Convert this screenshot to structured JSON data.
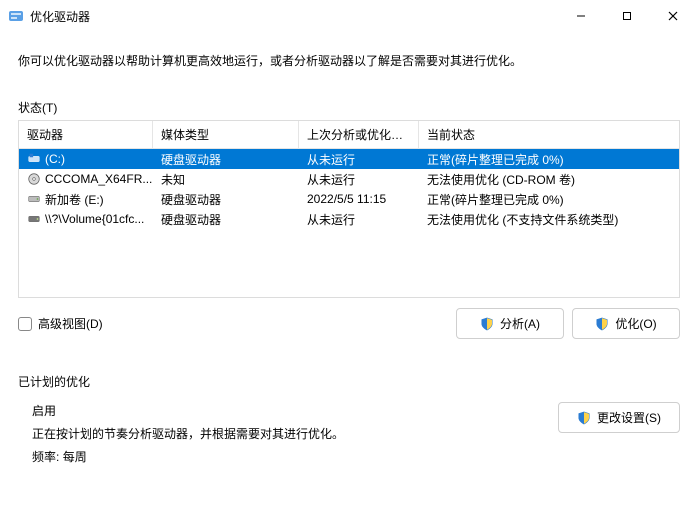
{
  "window": {
    "title": "优化驱动器"
  },
  "description": "你可以优化驱动器以帮助计算机更高效地运行，或者分析驱动器以了解是否需要对其进行优化。",
  "status_label": "状态(T)",
  "columns": {
    "drive": "驱动器",
    "media": "媒体类型",
    "last": "上次分析或优化的...",
    "state": "当前状态"
  },
  "rows": [
    {
      "drive": "(C:)",
      "media": "硬盘驱动器",
      "last": "从未运行",
      "state": "正常(碎片整理已完成 0%)",
      "icon": "drive-os",
      "selected": true
    },
    {
      "drive": "CCCOMA_X64FR...",
      "media": "未知",
      "last": "从未运行",
      "state": "无法使用优化 (CD-ROM 卷)",
      "icon": "drive-cd",
      "selected": false
    },
    {
      "drive": "新加卷 (E:)",
      "media": "硬盘驱动器",
      "last": "2022/5/5 11:15",
      "state": "正常(碎片整理已完成 0%)",
      "icon": "drive-hdd",
      "selected": false
    },
    {
      "drive": "\\\\?\\Volume{01cfc...",
      "media": "硬盘驱动器",
      "last": "从未运行",
      "state": "无法使用优化 (不支持文件系统类型)",
      "icon": "drive-vol",
      "selected": false
    }
  ],
  "advanced_view": "高级视图(D)",
  "buttons": {
    "analyze": "分析(A)",
    "optimize": "优化(O)",
    "change_settings": "更改设置(S)"
  },
  "scheduled": {
    "title": "已计划的优化",
    "on": "启用",
    "desc": "正在按计划的节奏分析驱动器，并根据需要对其进行优化。",
    "freq_label": "频率:",
    "freq_value": "每周"
  }
}
